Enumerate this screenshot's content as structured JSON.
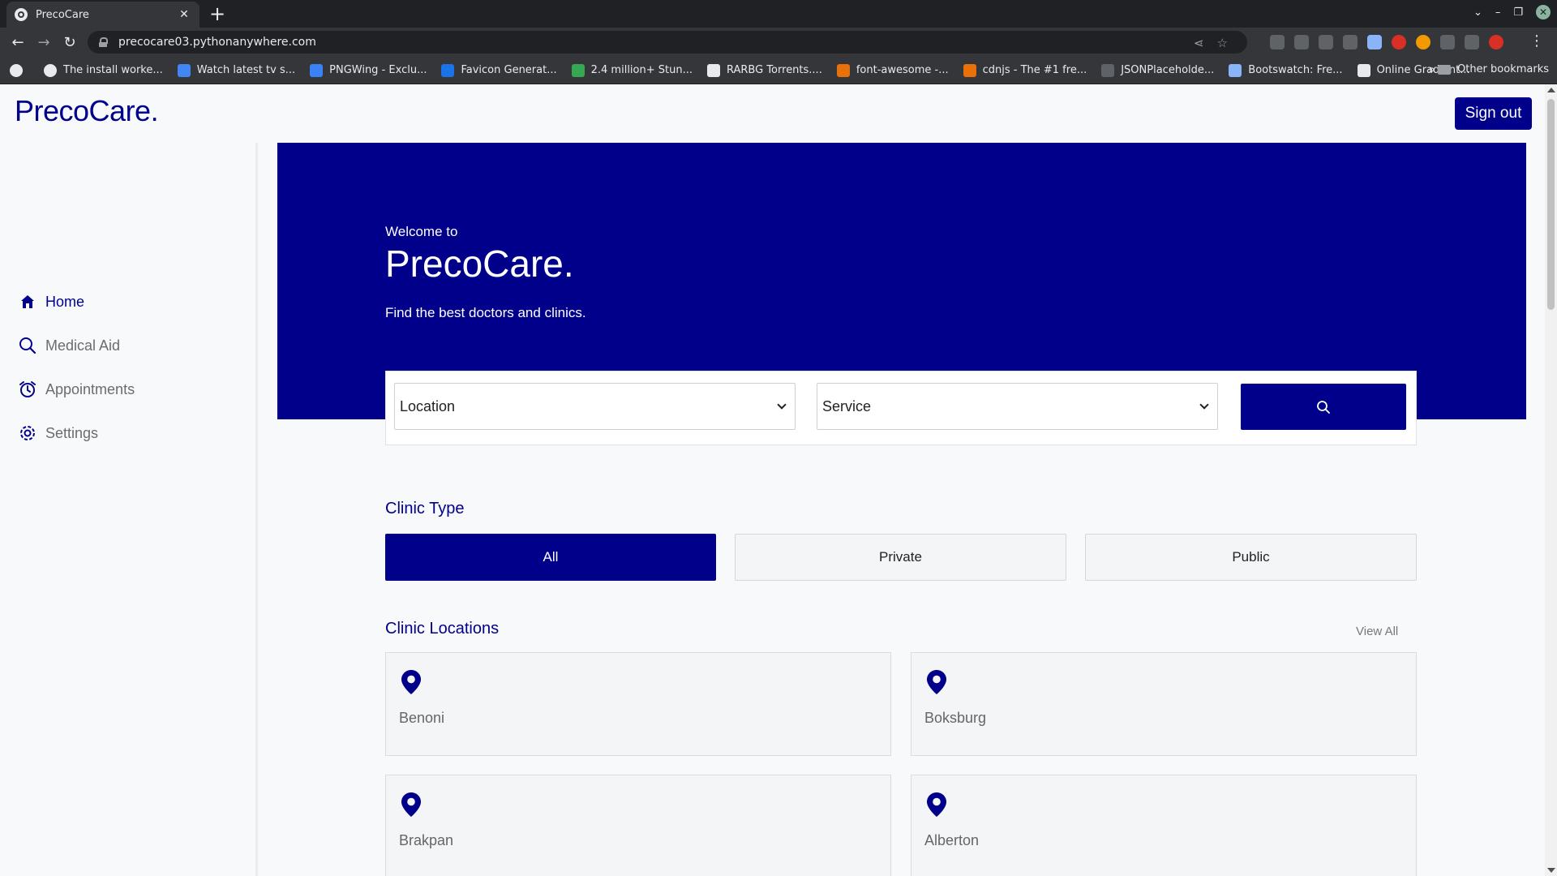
{
  "browser": {
    "tab_title": "PrecoCare",
    "url": "precocare03.pythonanywhere.com",
    "bookmarks": [
      {
        "label": "The install worke...",
        "color": "#e8eaed"
      },
      {
        "label": "Watch latest tv s...",
        "color": "#4285f4"
      },
      {
        "label": "PNGWing - Exclu...",
        "color": "#3b82f6"
      },
      {
        "label": "Favicon Generat...",
        "color": "#1a73e8"
      },
      {
        "label": "2.4 million+ Stun...",
        "color": "#34a853"
      },
      {
        "label": "RARBG Torrents....",
        "color": "#e8eaed"
      },
      {
        "label": "font-awesome -...",
        "color": "#e8710a"
      },
      {
        "label": "cdnjs - The #1 fre...",
        "color": "#e8710a"
      },
      {
        "label": "JSONPlaceholde...",
        "color": "#5f6368"
      },
      {
        "label": "Bootswatch: Fre...",
        "color": "#8ab4f8"
      },
      {
        "label": "Online Gradient...",
        "color": "#e8eaed"
      }
    ],
    "more_bookmarks": "»",
    "other_bookmarks": "Other bookmarks"
  },
  "header": {
    "brand": "PrecoCare.",
    "sign_out": "Sign out"
  },
  "sidebar": {
    "items": [
      {
        "label": "Home",
        "icon": "home-icon",
        "active": true
      },
      {
        "label": "Medical Aid",
        "icon": "search-icon",
        "active": false
      },
      {
        "label": "Appointments",
        "icon": "alarm-clock-icon",
        "active": false
      },
      {
        "label": "Settings",
        "icon": "gear-icon",
        "active": false
      }
    ]
  },
  "hero": {
    "pre_title": "Welcome to",
    "title": "PrecoCare.",
    "subtitle": "Find the best doctors and clinics."
  },
  "search": {
    "location": "Location",
    "service": "Service"
  },
  "clinic_type": {
    "title": "Clinic Type",
    "options": [
      "All",
      "Private",
      "Public"
    ],
    "selected": "All"
  },
  "clinic_locations": {
    "title": "Clinic Locations",
    "view_all": "View All",
    "items": [
      "Benoni",
      "Boksburg",
      "Brakpan",
      "Alberton"
    ]
  },
  "colors": {
    "primary": "#00008b",
    "background": "#f8f9fa",
    "card": "#f4f5f7"
  }
}
